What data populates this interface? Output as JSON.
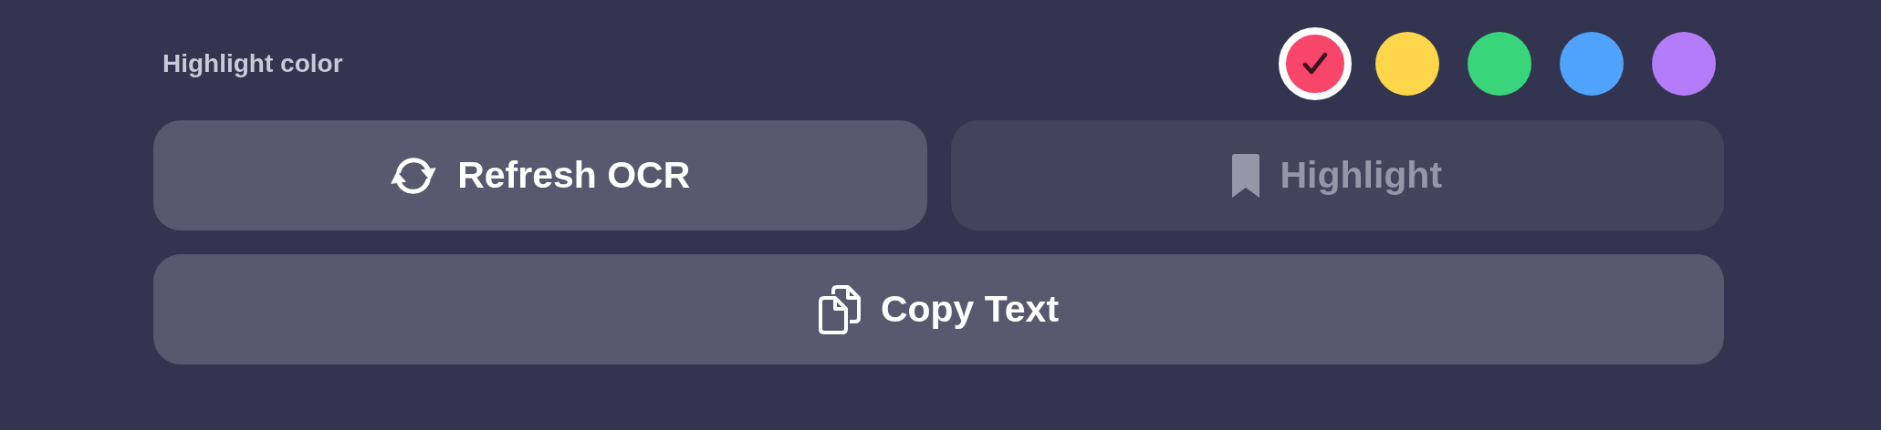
{
  "highlight_color": {
    "label": "Highlight color",
    "swatches": [
      {
        "color": "#f7466a",
        "selected": true
      },
      {
        "color": "#fdd64b",
        "selected": false
      },
      {
        "color": "#38d57a",
        "selected": false
      },
      {
        "color": "#4fa3fd",
        "selected": false
      },
      {
        "color": "#b47cfb",
        "selected": false
      }
    ]
  },
  "buttons": [
    {
      "label": "Refresh OCR",
      "kind": "refresh",
      "disabled": false
    },
    {
      "label": "Highlight",
      "kind": "bookmark",
      "disabled": true
    },
    {
      "label": "Copy Text",
      "kind": "copy",
      "disabled": false
    }
  ]
}
